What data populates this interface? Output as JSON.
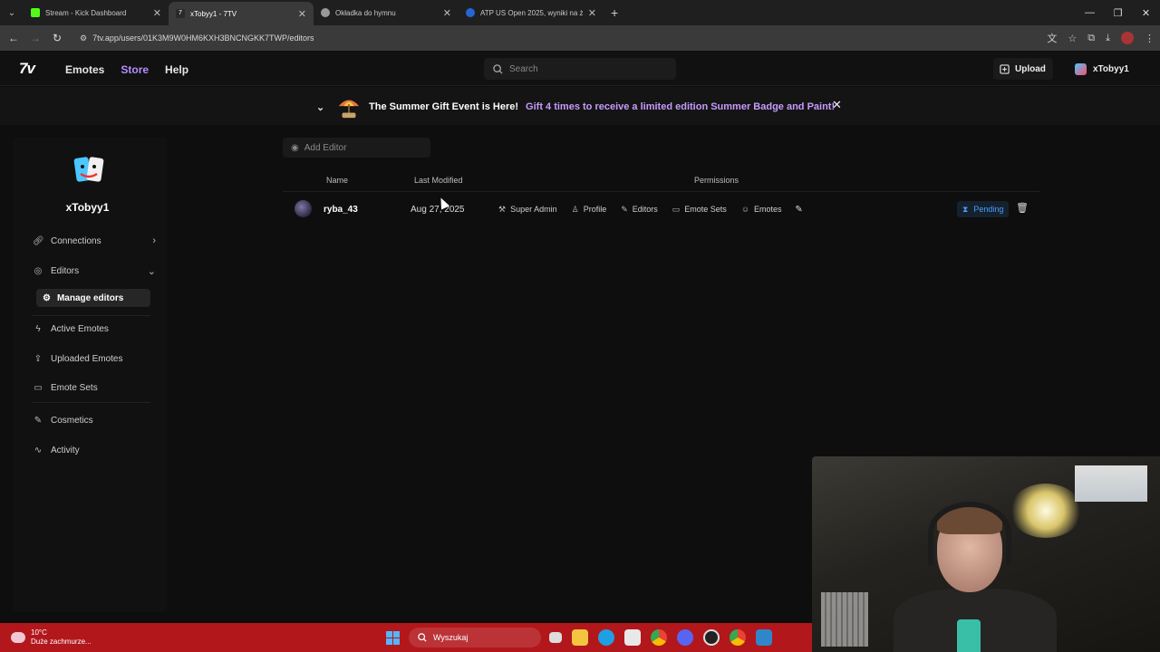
{
  "browser": {
    "tabs": [
      {
        "title": "Stream - Kick Dashboard",
        "favicon_color": "#53fc18",
        "active": false
      },
      {
        "title": "xTobyy1 - 7TV",
        "favicon_color": "#2a2a2a",
        "active": true
      },
      {
        "title": "Okładka do hymnu",
        "favicon_color": "#9a9a9a",
        "active": false
      },
      {
        "title": "ATP US Open 2025, wyniki na ż",
        "favicon_color": "#2566d6",
        "active": false
      }
    ],
    "url": "7tv.app/users/01K3M9W0HM6KXH3BNCNGKK7TWP/editors"
  },
  "header": {
    "logo": "7v",
    "nav": {
      "emotes": "Emotes",
      "store": "Store",
      "help": "Help"
    },
    "search_placeholder": "Search",
    "upload_label": "Upload",
    "username": "xTobyy1"
  },
  "banner": {
    "title": "The Summer Gift Event is Here!",
    "text": "Gift 4 times to receive a limited edition Summer Badge and Paint!"
  },
  "sidebar": {
    "username": "xTobyy1",
    "items": {
      "connections": "Connections",
      "editors": "Editors",
      "manage_editors": "Manage editors",
      "active_emotes": "Active Emotes",
      "uploaded_emotes": "Uploaded Emotes",
      "emote_sets": "Emote Sets",
      "cosmetics": "Cosmetics",
      "activity": "Activity"
    }
  },
  "editors": {
    "add_placeholder": "Add Editor",
    "columns": {
      "name": "Name",
      "last_modified": "Last Modified",
      "permissions": "Permissions"
    },
    "rows": [
      {
        "name": "ryba_43",
        "last_modified": "Aug 27, 2025",
        "permissions": {
          "super_admin": "Super Admin",
          "profile": "Profile",
          "editors": "Editors",
          "emote_sets": "Emote Sets",
          "emotes": "Emotes"
        },
        "status": "Pending"
      }
    ]
  },
  "taskbar": {
    "temperature": "10°C",
    "weather": "Duże zachmurze...",
    "search": "Wyszukaj"
  },
  "colors": {
    "accent": "#b58cff",
    "banner_text": "#c79bff",
    "pending": "#4a9eff",
    "taskbar": "#b2171c"
  }
}
